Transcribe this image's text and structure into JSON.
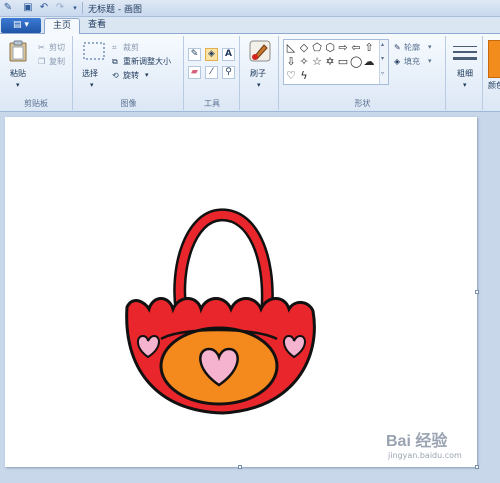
{
  "app": {
    "title": "无标题 - 画图"
  },
  "quick_access": [
    "app-icon",
    "save-icon",
    "undo-icon",
    "redo-icon",
    "dropdown-icon"
  ],
  "tabs": [
    {
      "label": "主页",
      "active": true
    },
    {
      "label": "查看",
      "active": false
    }
  ],
  "ribbon": {
    "clipboard": {
      "label": "剪贴板",
      "paste": "粘贴",
      "cut": "剪切",
      "copy": "复制"
    },
    "image": {
      "label": "图像",
      "select": "选择",
      "crop": "裁剪",
      "resize": "重新调整大小",
      "rotate": "旋转"
    },
    "tools": {
      "label": "工具",
      "icons": [
        "pencil-icon",
        "fill-icon",
        "text-icon",
        "eraser-icon",
        "color-picker-icon",
        "magnifier-icon"
      ],
      "text_glyph": "A"
    },
    "brushes": {
      "label": "刷子"
    },
    "shapes": {
      "label": "形状",
      "outline": "轮廓",
      "fill": "填充"
    },
    "size": {
      "label": "粗细"
    },
    "colors": {
      "label": "颜色"
    }
  },
  "colors": {
    "accent": "#2b5797",
    "bag_red": "#e8262b",
    "bag_orange": "#f48a1e",
    "heart_pink": "#f6b3cf"
  },
  "watermark": {
    "text": "Bai 经验",
    "url": "jingyan.baidu.com"
  }
}
